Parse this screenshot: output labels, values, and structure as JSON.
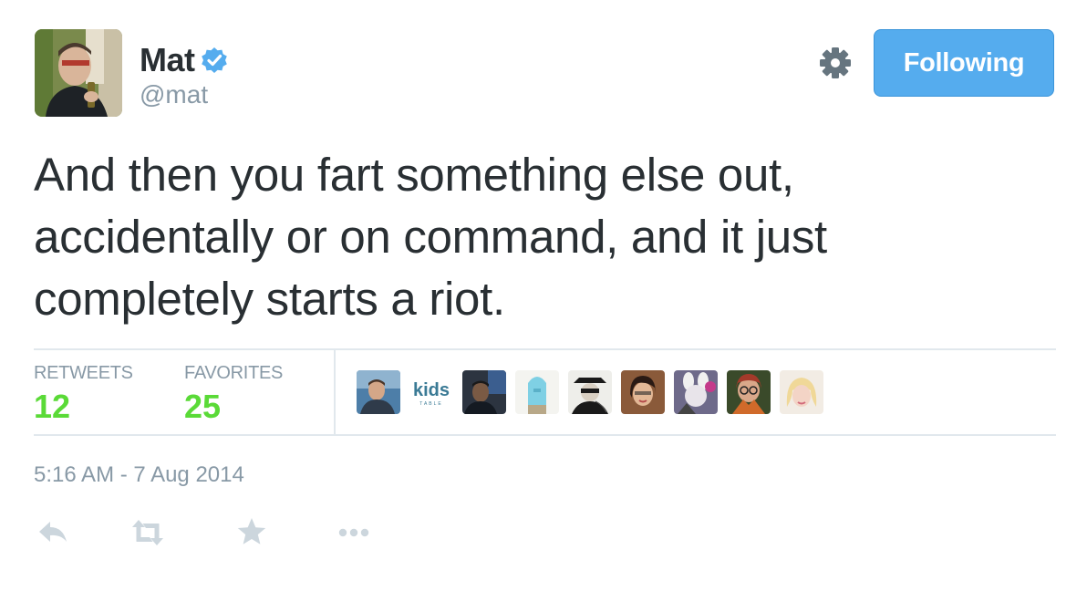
{
  "author": {
    "display_name": "Mat",
    "username": "@mat",
    "avatar_icon": "avatar-photo",
    "verified_icon": "verified-badge-icon"
  },
  "header": {
    "settings_icon": "gear-icon",
    "follow_label": "Following"
  },
  "tweet": {
    "text": "And then you fart something else out, accidentally or on command, and it just completely starts a riot."
  },
  "stats": {
    "retweets_label": "RETWEETS",
    "retweets_count": "12",
    "favorites_label": "FAVORITES",
    "favorites_count": "25",
    "favoriter_avatars": [
      {
        "name": "favoriter-avatar-1"
      },
      {
        "name": "favoriter-avatar-kids-table",
        "logo_text": "kids",
        "logo_subtext": "TABLE"
      },
      {
        "name": "favoriter-avatar-3"
      },
      {
        "name": "favoriter-avatar-4"
      },
      {
        "name": "favoriter-avatar-5"
      },
      {
        "name": "favoriter-avatar-6"
      },
      {
        "name": "favoriter-avatar-7"
      },
      {
        "name": "favoriter-avatar-8"
      },
      {
        "name": "favoriter-avatar-9"
      }
    ]
  },
  "timestamp": "5:16 AM - 7 Aug 2014",
  "actions": [
    {
      "name": "reply-icon"
    },
    {
      "name": "retweet-icon"
    },
    {
      "name": "favorite-icon"
    },
    {
      "name": "more-icon"
    }
  ],
  "colors": {
    "accent": "#55acee",
    "stat_value": "#5ada37",
    "muted": "#8899a6",
    "text": "#292f33",
    "divider": "#e1e8ed",
    "action_icon": "#ccd6dd"
  }
}
